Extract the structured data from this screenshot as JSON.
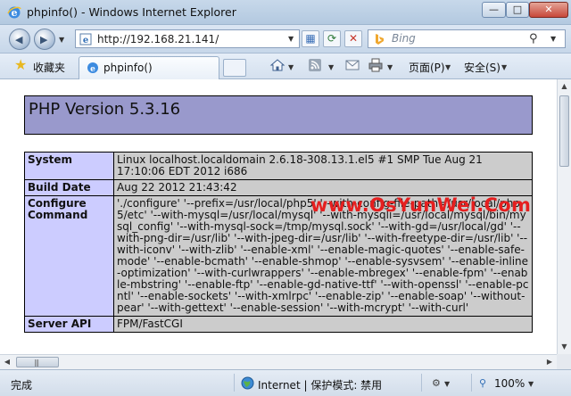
{
  "window": {
    "title": "phpinfo() - Windows Internet Explorer",
    "minimize_label": "—",
    "maximize_label": "□",
    "close_label": "✕"
  },
  "address": {
    "url": "http://192.168.21.141/",
    "search_placeholder": "Bing"
  },
  "favorites_bar": {
    "favorites_label": "收藏夹",
    "tab_label": "phpinfo()",
    "page_menu_label": "页面(P)",
    "safety_menu_label": "安全(S)"
  },
  "page": {
    "header_title": "PHP Version 5.3.16",
    "watermark": "www.OsYunWei.Com",
    "rows": [
      {
        "key": "System",
        "value": "Linux localhost.localdomain 2.6.18-308.13.1.el5 #1 SMP Tue Aug 21 17:10:06 EDT 2012 i686"
      },
      {
        "key": "Build Date",
        "value": "Aug 22 2012 21:43:42"
      },
      {
        "key": "Configure Command",
        "value": "'./configure' '--prefix=/usr/local/php5' '--with-config-file-path=/usr/local/php5/etc' '--with-mysql=/usr/local/mysql' '--with-mysqli=/usr/local/mysql/bin/mysql_config' '--with-mysql-sock=/tmp/mysql.sock' '--with-gd=/usr/local/gd' '--with-png-dir=/usr/lib' '--with-jpeg-dir=/usr/lib' '--with-freetype-dir=/usr/lib' '--with-iconv' '--with-zlib' '--enable-xml' '--enable-magic-quotes' '--enable-safe-mode' '--enable-bcmath' '--enable-shmop' '--enable-sysvsem' '--enable-inline-optimization' '--with-curlwrappers' '--enable-mbregex' '--enable-fpm' '--enable-mbstring' '--enable-ftp' '--enable-gd-native-ttf' '--with-openssl' '--enable-pcntl' '--enable-sockets' '--with-xmlrpc' '--enable-zip' '--enable-soap' '--without-pear' '--with-gettext' '--enable-session' '--with-mcrypt' '--with-curl'"
      },
      {
        "key": "Server API",
        "value": "FPM/FastCGI"
      }
    ]
  },
  "status": {
    "text": "完成",
    "zone": "Internet | 保护模式: 禁用",
    "zoom": "100%"
  },
  "colors": {
    "php_header": "#9999cc",
    "table_key": "#ccccff",
    "table_value": "#cccccc",
    "watermark": "#e51f1f"
  }
}
